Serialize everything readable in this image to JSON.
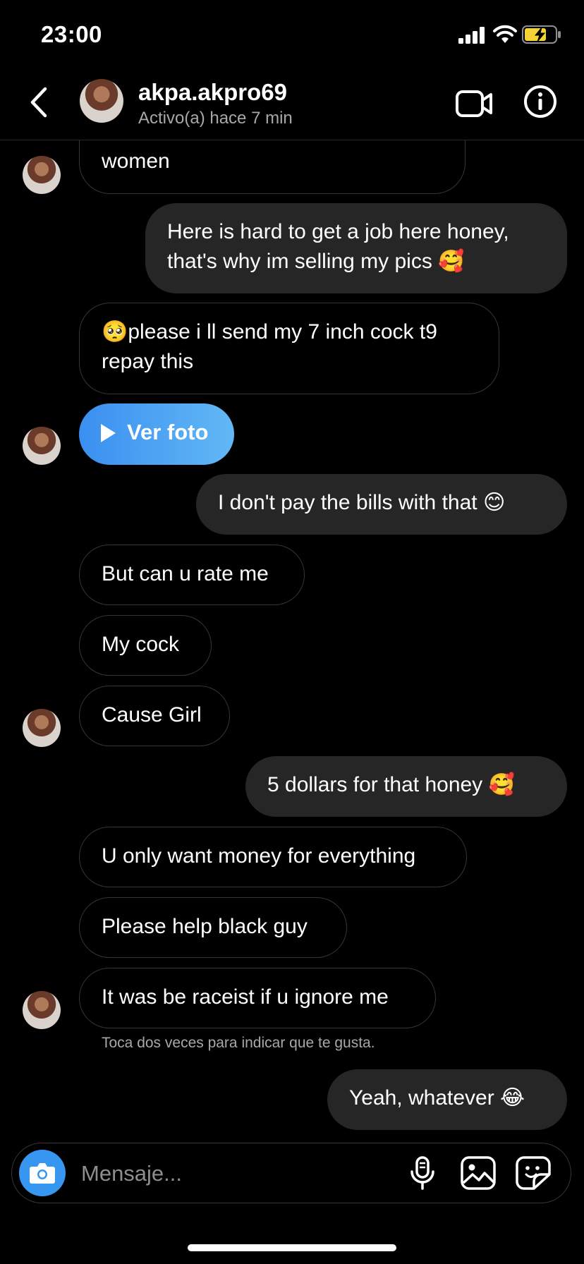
{
  "status_bar": {
    "time": "23:00",
    "icons": [
      "cellular-signal-icon",
      "wifi-icon",
      "battery-charging-icon"
    ]
  },
  "header": {
    "username": "akpa.akpro69",
    "activity": "Activo(a) hace 7 min",
    "icons": [
      "back-chevron-icon",
      "video-call-icon",
      "info-icon"
    ]
  },
  "messages": [
    {
      "sender": "them",
      "text": "women"
    },
    {
      "sender": "me",
      "text": "Here is hard to get a job here honey, that's why im selling my pics 🥰"
    },
    {
      "sender": "them",
      "text": "🥺please i ll send my 7 inch cock t9 repay this"
    },
    {
      "sender": "them",
      "type": "photo",
      "text": "Ver foto"
    },
    {
      "sender": "me",
      "text": "I don't pay the bills with that 😊"
    },
    {
      "sender": "them",
      "text": "But can u rate me"
    },
    {
      "sender": "them",
      "text": "My cock"
    },
    {
      "sender": "them",
      "text": "Cause Girl"
    },
    {
      "sender": "me",
      "text": "5 dollars for that honey 🥰"
    },
    {
      "sender": "them",
      "text": "U only want money for everything"
    },
    {
      "sender": "them",
      "text": "Please help black guy"
    },
    {
      "sender": "them",
      "text": "It was be raceist if u ignore me"
    },
    {
      "sender": "me",
      "text": "Yeah, whatever 😂"
    }
  ],
  "hint": "Toca dos veces para indicar que te gusta.",
  "composer": {
    "placeholder": "Mensaje...",
    "icons": [
      "camera-icon",
      "microphone-icon",
      "gallery-icon",
      "sticker-icon"
    ]
  },
  "colors": {
    "background": "#000000",
    "outgoing_bubble": "#262626",
    "incoming_border": "#363636",
    "accent_blue": "#3797f0",
    "secondary_text": "#a8a8a8"
  }
}
